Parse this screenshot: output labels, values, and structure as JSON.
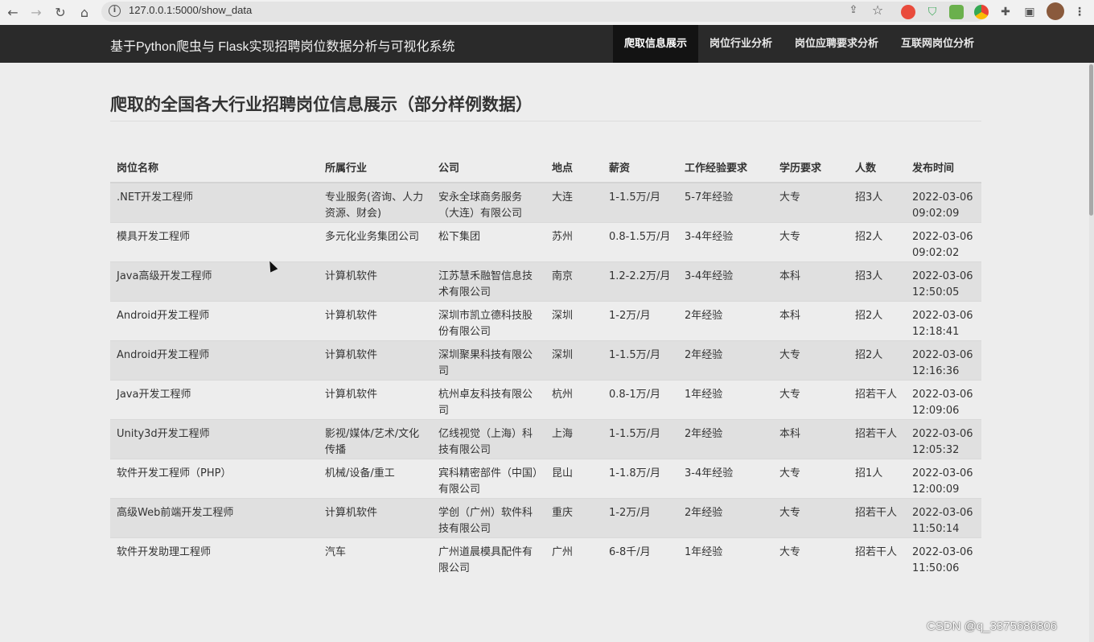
{
  "browser": {
    "url": "127.0.0.1:5000/show_data",
    "nav_icons": [
      "back-arrow-icon",
      "forward-arrow-icon",
      "reload-icon",
      "home-icon"
    ],
    "extension_icons": [
      "share-icon",
      "star-icon",
      "extension-red-icon",
      "shield-icon",
      "android-icon",
      "chrome-icon",
      "puzzle-icon",
      "sidebar-icon",
      "profile-avatar",
      "kebab-menu-icon"
    ]
  },
  "navbar": {
    "brand": "基于Python爬虫与 Flask实现招聘岗位数据分析与可视化系统",
    "items": [
      {
        "label": "爬取信息展示",
        "active": true
      },
      {
        "label": "岗位行业分析",
        "active": false
      },
      {
        "label": "岗位应聘要求分析",
        "active": false
      },
      {
        "label": "互联网岗位分析",
        "active": false
      }
    ]
  },
  "page": {
    "heading": "爬取的全国各大行业招聘岗位信息展示（部分样例数据）"
  },
  "table": {
    "headers": [
      "岗位名称",
      "所属行业",
      "公司",
      "地点",
      "薪资",
      "工作经验要求",
      "学历要求",
      "人数",
      "发布时间"
    ],
    "rows": [
      [
        ".NET开发工程师",
        "专业服务(咨询、人力资源、财会)",
        "安永全球商务服务（大连）有限公司",
        "大连",
        "1-1.5万/月",
        "5-7年经验",
        "大专",
        "招3人",
        "2022-03-06 09:02:09"
      ],
      [
        "模具开发工程师",
        "多元化业务集团公司",
        "松下集团",
        "苏州",
        "0.8-1.5万/月",
        "3-4年经验",
        "大专",
        "招2人",
        "2022-03-06 09:02:02"
      ],
      [
        "Java高级开发工程师",
        "计算机软件",
        "江苏慧禾融智信息技术有限公司",
        "南京",
        "1.2-2.2万/月",
        "3-4年经验",
        "本科",
        "招3人",
        "2022-03-06 12:50:05"
      ],
      [
        "Android开发工程师",
        "计算机软件",
        "深圳市凯立德科技股份有限公司",
        "深圳",
        "1-2万/月",
        "2年经验",
        "本科",
        "招2人",
        "2022-03-06 12:18:41"
      ],
      [
        "Android开发工程师",
        "计算机软件",
        "深圳聚果科技有限公司",
        "深圳",
        "1-1.5万/月",
        "2年经验",
        "大专",
        "招2人",
        "2022-03-06 12:16:36"
      ],
      [
        "Java开发工程师",
        "计算机软件",
        "杭州卓友科技有限公司",
        "杭州",
        "0.8-1万/月",
        "1年经验",
        "大专",
        "招若干人",
        "2022-03-06 12:09:06"
      ],
      [
        "Unity3d开发工程师",
        "影视/媒体/艺术/文化传播",
        "亿线视觉（上海）科技有限公司",
        "上海",
        "1-1.5万/月",
        "2年经验",
        "本科",
        "招若干人",
        "2022-03-06 12:05:32"
      ],
      [
        "软件开发工程师（PHP）",
        "机械/设备/重工",
        "宾科精密部件（中国）有限公司",
        "昆山",
        "1-1.8万/月",
        "3-4年经验",
        "大专",
        "招1人",
        "2022-03-06 12:00:09"
      ],
      [
        "高级Web前端开发工程师",
        "计算机软件",
        "学创（广州）软件科技有限公司",
        "重庆",
        "1-2万/月",
        "2年经验",
        "大专",
        "招若干人",
        "2022-03-06 11:50:14"
      ],
      [
        "软件开发助理工程师",
        "汽车",
        "广州道晨模具配件有限公司",
        "广州",
        "6-8千/月",
        "1年经验",
        "大专",
        "招若干人",
        "2022-03-06 11:50:06"
      ]
    ]
  },
  "watermark": "CSDN @q_3375686806"
}
